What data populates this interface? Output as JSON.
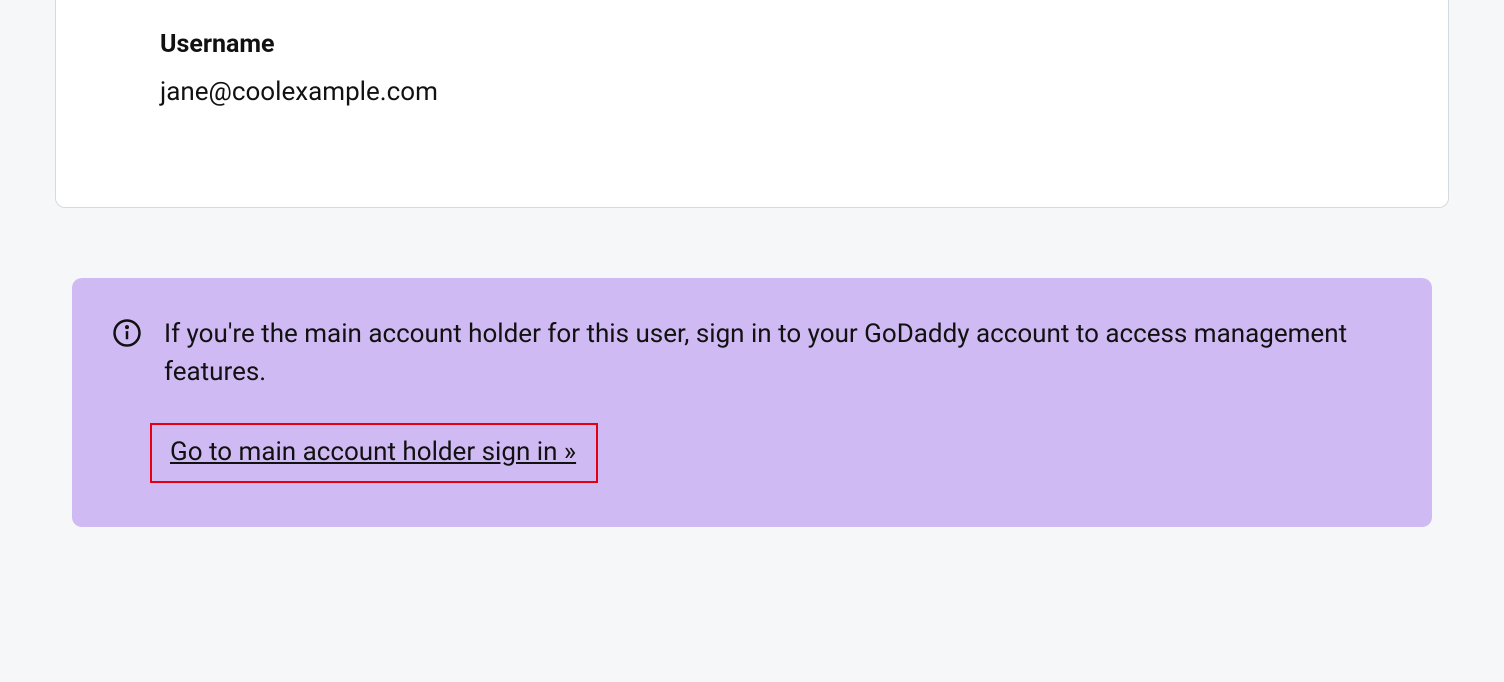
{
  "card": {
    "username_label": "Username",
    "username_value": "jane@coolexample.com"
  },
  "banner": {
    "info_text": "If you're the main account holder for this user, sign in to your GoDaddy account to access management features.",
    "link_text": "Go to main account holder sign in »"
  }
}
